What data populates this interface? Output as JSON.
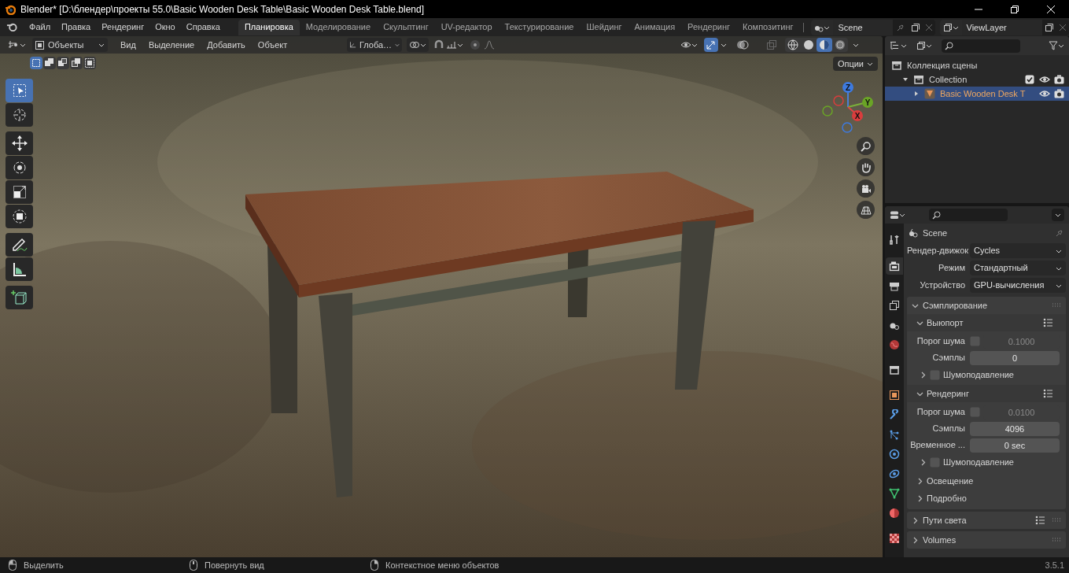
{
  "window": {
    "title": "Blender* [D:\\блендер\\проекты 55.0\\Basic Wooden Desk Table\\Basic Wooden Desk Table.blend]"
  },
  "menus": [
    "Файл",
    "Правка",
    "Рендеринг",
    "Окно",
    "Справка"
  ],
  "workspaces": [
    {
      "label": "Планировка",
      "selected": true
    },
    {
      "label": "Моделирование",
      "selected": false
    },
    {
      "label": "Скульптинг",
      "selected": false
    },
    {
      "label": "UV-редактор",
      "selected": false
    },
    {
      "label": "Текстурирование",
      "selected": false
    },
    {
      "label": "Шейдинг",
      "selected": false
    },
    {
      "label": "Анимация",
      "selected": false
    },
    {
      "label": "Рендеринг",
      "selected": false
    },
    {
      "label": "Композитинг",
      "selected": false
    }
  ],
  "scene_field": {
    "value": "Scene"
  },
  "view_layer_field": {
    "value": "ViewLayer"
  },
  "viewport": {
    "mode": "Объекты",
    "menus": [
      "Вид",
      "Выделение",
      "Добавить",
      "Объект"
    ],
    "orientation": "Глоба…",
    "options": "Опции",
    "select_modes": [
      {
        "selected": true
      },
      {
        "selected": false
      },
      {
        "selected": false
      },
      {
        "selected": false
      },
      {
        "selected": false
      }
    ],
    "tools": [
      {
        "kind": "select",
        "selected": true
      },
      {
        "kind": "cursor",
        "selected": false
      },
      {
        "kind": "move",
        "selected": false
      },
      {
        "kind": "rotate",
        "selected": false
      },
      {
        "kind": "scale",
        "selected": false
      },
      {
        "kind": "transform",
        "selected": false
      },
      {
        "kind": "annotate",
        "selected": false
      },
      {
        "kind": "measure",
        "selected": false
      },
      {
        "kind": "add_cube",
        "selected": false
      }
    ],
    "axes": [
      "Z",
      "Y",
      "X"
    ],
    "gizmo_toggle": {
      "selected": true
    },
    "shading": [
      {
        "selected": false
      },
      {
        "selected": false
      },
      {
        "selected": true
      },
      {
        "selected": false
      }
    ]
  },
  "outliner": {
    "items": [
      {
        "label": "Коллекция сцены",
        "children": [
          {
            "label": "Collection",
            "expanded": true,
            "checked": true,
            "children": [
              {
                "label": "Basic Wooden Desk T",
                "selected": true,
                "expanded": false
              }
            ]
          }
        ]
      }
    ]
  },
  "properties": {
    "tabs": [
      {
        "kind": "tool",
        "selected": false
      },
      {
        "kind": "render",
        "selected": true
      },
      {
        "kind": "output",
        "selected": false
      },
      {
        "kind": "view_layer",
        "selected": false
      },
      {
        "kind": "scene",
        "selected": false
      },
      {
        "kind": "world",
        "selected": false
      },
      {
        "kind": "collection",
        "selected": false
      },
      {
        "kind": "object",
        "selected": false
      },
      {
        "kind": "modifier",
        "selected": false
      },
      {
        "kind": "particles",
        "selected": false
      },
      {
        "kind": "physics",
        "selected": false
      },
      {
        "kind": "constraints",
        "selected": false
      },
      {
        "kind": "data",
        "selected": false
      },
      {
        "kind": "material",
        "selected": false
      },
      {
        "kind": "texture",
        "selected": false
      }
    ],
    "header": "Scene",
    "fields": [
      {
        "label": "Рендер-движок",
        "value": "Cycles"
      },
      {
        "label": "Режим",
        "value": "Стандартный"
      },
      {
        "label": "Устройство",
        "value": "GPU-вычисления"
      }
    ],
    "panels": [
      {
        "label": "Сэмплирование",
        "expanded": true,
        "presets": false,
        "children": [
          {
            "kind": "subpanel",
            "label": "Выюпорт",
            "expanded": true,
            "presets": true,
            "children": [
              {
                "kind": "number",
                "label": "Порог шума",
                "toggle": true,
                "checked": false,
                "value": "0.1000"
              },
              {
                "kind": "number",
                "label": "Сэмплы",
                "toggle": false,
                "value": "0"
              },
              {
                "kind": "subpanel",
                "label": "Шумоподавление",
                "expanded": false,
                "toggle": true,
                "checked": false
              }
            ]
          },
          {
            "kind": "subpanel",
            "label": "Рендеринг",
            "expanded": true,
            "presets": true,
            "children": [
              {
                "kind": "number",
                "label": "Порог шума",
                "toggle": true,
                "checked": false,
                "value": "0.0100"
              },
              {
                "kind": "number",
                "label": "Сэмплы",
                "toggle": false,
                "value": "4096"
              },
              {
                "kind": "number",
                "label": "Временное ...",
                "toggle": false,
                "value": "0 sec"
              },
              {
                "kind": "subpanel",
                "label": "Шумоподавление",
                "expanded": false,
                "toggle": true,
                "checked": false
              }
            ]
          },
          {
            "kind": "subpanel",
            "label": "Освещение",
            "expanded": false
          },
          {
            "kind": "subpanel",
            "label": "Подробно",
            "expanded": false
          }
        ]
      },
      {
        "label": "Пути света",
        "expanded": false,
        "presets": true
      },
      {
        "label": "Volumes",
        "expanded": false,
        "presets": false
      }
    ]
  },
  "status_bar": {
    "hints": [
      "Выделить",
      "Повернуть вид",
      "Контекстное меню объектов"
    ],
    "version": "3.5.1"
  }
}
